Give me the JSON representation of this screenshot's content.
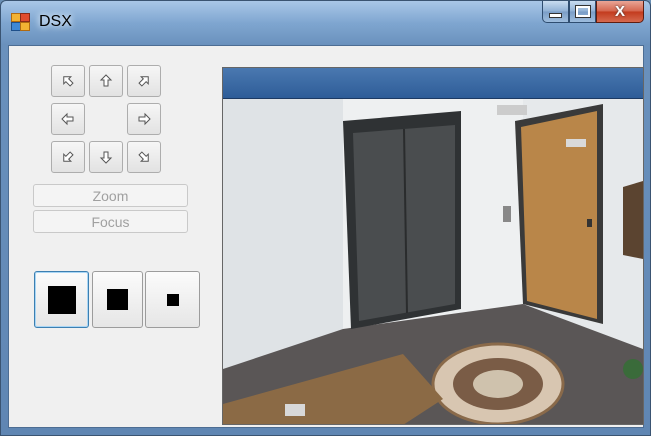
{
  "window": {
    "title": "DSX"
  },
  "caption": {
    "minimize": "—",
    "maximize": "▢",
    "close": "X"
  },
  "ptz": {
    "buttons": [
      {
        "name": "pan-up-left-button",
        "icon": "arrow-up-left-icon"
      },
      {
        "name": "tilt-up-button",
        "icon": "arrow-up-icon"
      },
      {
        "name": "pan-up-right-button",
        "icon": "arrow-up-right-icon"
      },
      {
        "name": "pan-left-button",
        "icon": "arrow-left-icon"
      },
      {
        "name": "pan-right-button",
        "icon": "arrow-right-icon"
      },
      {
        "name": "pan-down-left-button",
        "icon": "arrow-down-left-icon"
      },
      {
        "name": "tilt-down-button",
        "icon": "arrow-down-icon"
      },
      {
        "name": "pan-down-right-button",
        "icon": "arrow-down-right-icon"
      }
    ]
  },
  "controls": {
    "zoom_label": "Zoom",
    "focus_label": "Focus"
  },
  "view_size": {
    "options": [
      "large",
      "medium",
      "small"
    ],
    "selected": "large"
  },
  "colors": {
    "accent": "#3c7fb1",
    "video_header": "#2e5d98",
    "disabled_text": "#a0a0a0"
  }
}
